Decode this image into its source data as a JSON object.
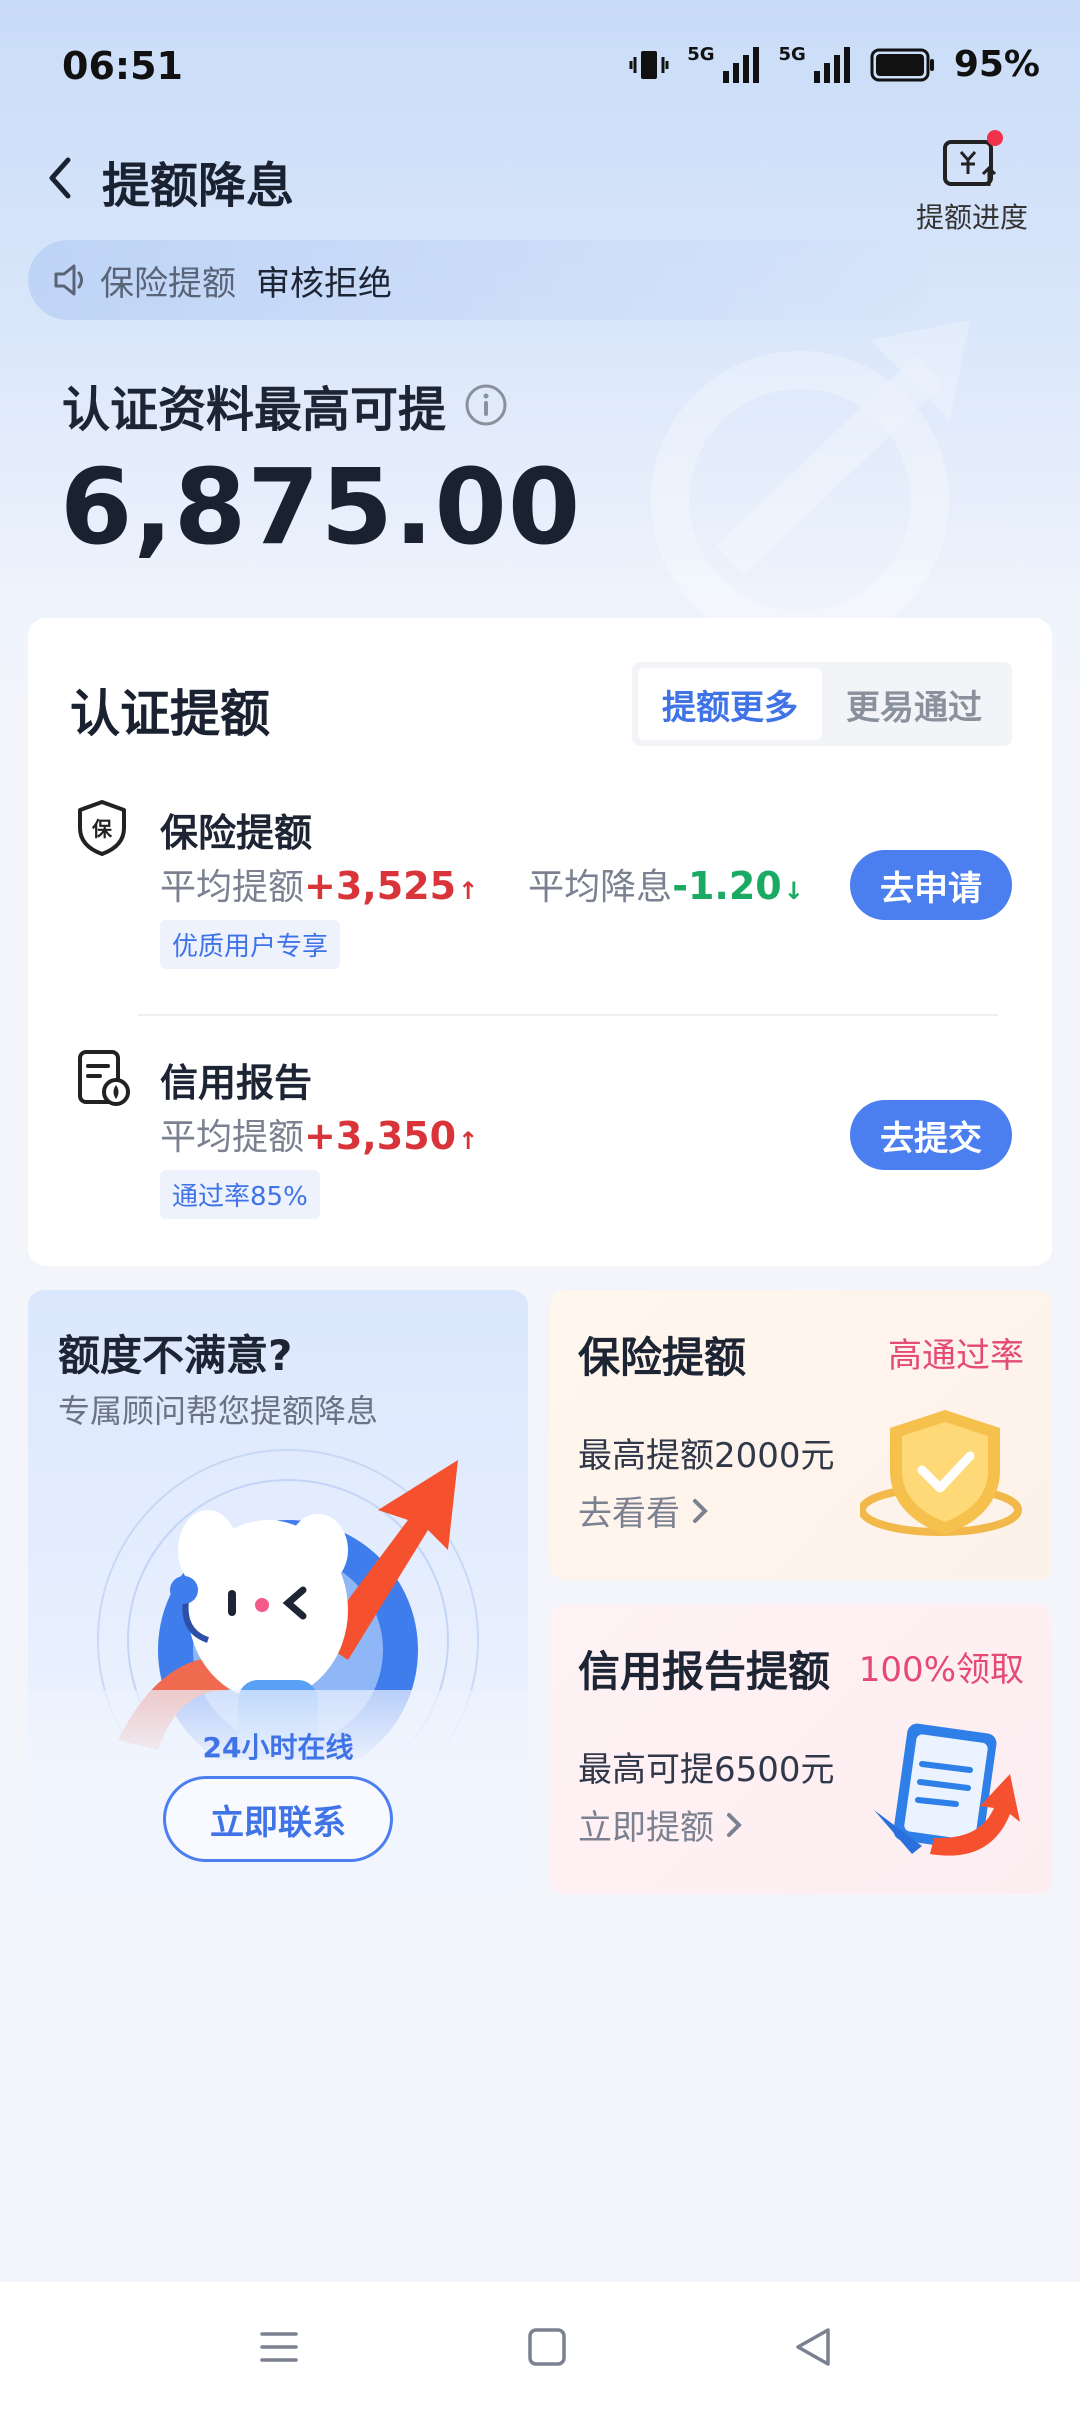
{
  "status_bar": {
    "time": "06:51",
    "signal_1": "5G",
    "signal_2": "5G",
    "battery": "95%"
  },
  "header": {
    "title": "提额降息",
    "progress_label": "提额进度"
  },
  "notice": {
    "label": "保险提额",
    "status": "审核拒绝"
  },
  "hero": {
    "label": "认证资料最高可提",
    "amount": "6,875.00"
  },
  "cert_card": {
    "title": "认证提额",
    "tabs": [
      {
        "label": "提额更多",
        "active": true
      },
      {
        "label": "更易通过",
        "active": false
      }
    ],
    "items": [
      {
        "name": "保险提额",
        "stat1_label": "平均提额",
        "stat1_value": "+3,525",
        "stat2_label": "平均降息",
        "stat2_value": "-1.20",
        "tag": "优质用户专享",
        "button": "去申请",
        "icon": "insurance-shield-icon"
      },
      {
        "name": "信用报告",
        "stat1_label": "平均提额",
        "stat1_value": "+3,350",
        "tag": "通过率85%",
        "button": "去提交",
        "icon": "credit-report-icon"
      }
    ]
  },
  "tiles": {
    "advisor": {
      "title": "额度不满意?",
      "subtitle": "专属顾问帮您提额降息",
      "online": "24小时在线",
      "button": "立即联系"
    },
    "insurance": {
      "title": "保险提额",
      "badge": "高通过率",
      "desc": "最高提额2000元",
      "link": "去看看"
    },
    "credit": {
      "title": "信用报告提额",
      "badge": "100%领取",
      "desc": "最高可提6500元",
      "link": "立即提额"
    }
  },
  "colors": {
    "accent": "#4b7ff0",
    "up": "#d9343a",
    "down": "#1aaa64",
    "badge_pink": "#e44a74"
  }
}
